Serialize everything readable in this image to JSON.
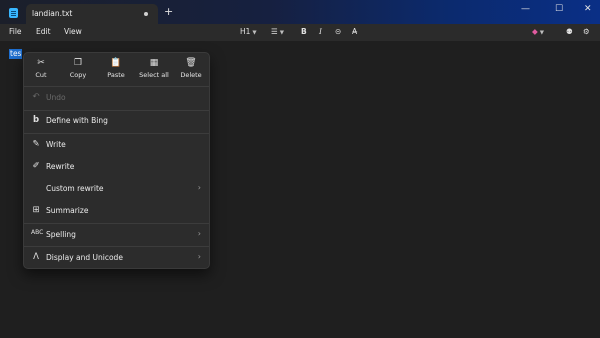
{
  "tab": {
    "title": "landian.txt",
    "new_tab": "+"
  },
  "window_controls": {
    "minimize": "—",
    "maximize": "☐",
    "close": "✕"
  },
  "menu": {
    "file": "File",
    "edit": "Edit",
    "view": "View"
  },
  "toolbar": {
    "heading": "H1",
    "bold": "B",
    "italic": "I",
    "link_glyph": "⊝",
    "clear_format": "A̶",
    "copilot_glyph": "◆"
  },
  "editor": {
    "selected_text": "tes"
  },
  "context_menu": {
    "quick_actions": [
      {
        "label": "Cut",
        "icon": "cut-icon",
        "glyph": "✂"
      },
      {
        "label": "Copy",
        "icon": "copy-icon",
        "glyph": "❐"
      },
      {
        "label": "Paste",
        "icon": "paste-icon",
        "glyph": "📋"
      },
      {
        "label": "Select all",
        "icon": "select-all-icon",
        "glyph": "▦"
      },
      {
        "label": "Delete",
        "icon": "delete-icon",
        "glyph": "🗑"
      }
    ],
    "undo": "Undo",
    "define": "Define with Bing",
    "write": "Write",
    "rewrite": "Rewrite",
    "custom_rewrite": "Custom rewrite",
    "summarize": "Summarize",
    "spelling": "Spelling",
    "display_unicode": "Display and Unicode"
  },
  "colors": {
    "selection": "#1e6fd0",
    "app_icon": "#39b7ff",
    "copilot": "#e05ba0"
  }
}
